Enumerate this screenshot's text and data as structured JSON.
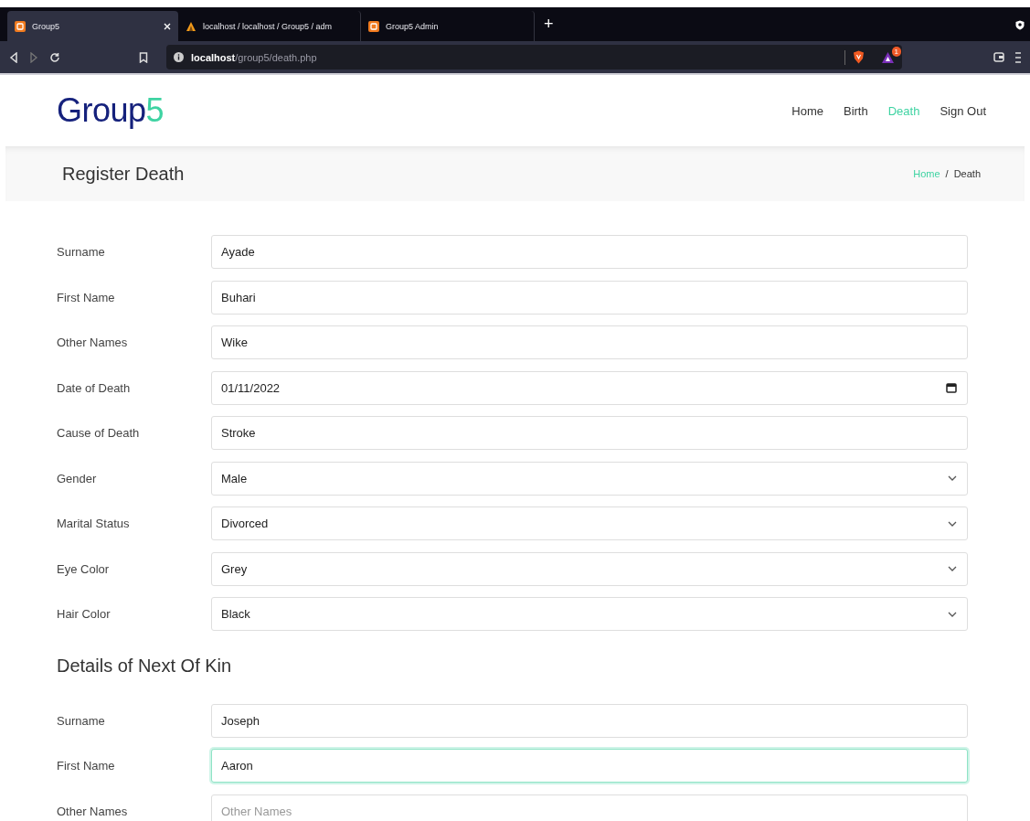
{
  "browser": {
    "tabs": [
      {
        "title": "Group5",
        "selected": true,
        "closable": true
      },
      {
        "title": "localhost / localhost / Group5 / adm",
        "selected": false,
        "closable": false
      },
      {
        "title": "Group5 Admin",
        "selected": false,
        "closable": false
      }
    ],
    "new_tab": "+",
    "address": {
      "host": "localhost",
      "path": "/group5/death.php"
    },
    "shield_badge": "1"
  },
  "site": {
    "logo": {
      "text": "Group",
      "accent": "5"
    },
    "nav": [
      {
        "label": "Home",
        "selected": false
      },
      {
        "label": "Birth",
        "selected": false
      },
      {
        "label": "Death",
        "selected": true
      },
      {
        "label": "Sign Out",
        "selected": false
      }
    ]
  },
  "page_title": "Register Death",
  "breadcrumb": {
    "separator": "/",
    "items": [
      {
        "label": "Home",
        "link": true
      },
      {
        "label": "Death",
        "link": false
      }
    ]
  },
  "sections": [
    {
      "fields": [
        {
          "label": "Surname",
          "kind": "text",
          "value": "Ayade",
          "focused": false
        },
        {
          "label": "First Name",
          "kind": "text",
          "value": "Buhari",
          "focused": false
        },
        {
          "label": "Other Names",
          "kind": "text",
          "value": "Wike",
          "focused": false
        },
        {
          "label": "Date of Death",
          "kind": "date",
          "value": "01/11/2022",
          "focused": false
        },
        {
          "label": "Cause of Death",
          "kind": "text",
          "value": "Stroke",
          "focused": false
        },
        {
          "label": "Gender",
          "kind": "select",
          "value": "Male",
          "focused": false
        },
        {
          "label": "Marital Status",
          "kind": "select",
          "value": "Divorced",
          "focused": false
        },
        {
          "label": "Eye Color",
          "kind": "select",
          "value": "Grey",
          "focused": false
        },
        {
          "label": "Hair Color",
          "kind": "select",
          "value": "Black",
          "focused": false
        }
      ]
    },
    {
      "heading": "Details of Next Of Kin",
      "fields": [
        {
          "label": "Surname",
          "kind": "text",
          "value": "Joseph",
          "focused": false
        },
        {
          "label": "First Name",
          "kind": "text",
          "value": "Aaron",
          "focused": true
        },
        {
          "label": "Other Names",
          "kind": "text",
          "placeholder": "Other Names",
          "focused": false
        }
      ]
    }
  ]
}
